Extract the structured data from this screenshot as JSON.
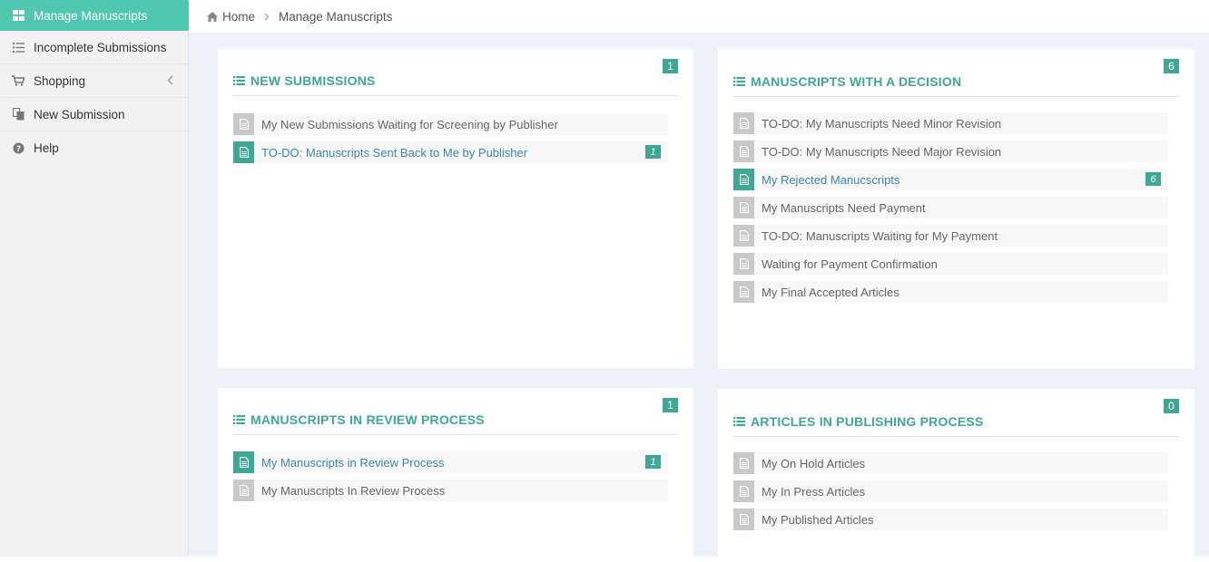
{
  "sidebar": {
    "items": [
      {
        "label": "Manage Manuscripts",
        "icon": "grid-icon",
        "active": true
      },
      {
        "label": "Incomplete Submissions",
        "icon": "list-icon"
      },
      {
        "label": "Shopping",
        "icon": "cart-icon",
        "has_submenu": true
      },
      {
        "label": "New Submission",
        "icon": "copy-icon"
      },
      {
        "label": "Help",
        "icon": "question-circle-icon"
      }
    ]
  },
  "breadcrumb": {
    "home": "Home",
    "current": "Manage Manuscripts"
  },
  "colors": {
    "accent": "#50c8b0",
    "title": "#3ea895",
    "link": "#3a86b0",
    "muted_icon": "#c9c9c9",
    "background": "#eef1f6"
  },
  "panels": {
    "new_submissions": {
      "title": "NEW SUBMISSIONS",
      "count": "1",
      "rows": [
        {
          "label": "My New Submissions Waiting for Screening by Publisher",
          "count": "",
          "highlight": false
        },
        {
          "label": "TO-DO: Manuscripts Sent Back to Me by Publisher",
          "count": "1",
          "highlight": true
        }
      ]
    },
    "decision": {
      "title": "MANUSCRIPTS WITH A DECISION",
      "count": "6",
      "rows": [
        {
          "label": "TO-DO: My Manuscripts Need Minor Revision",
          "count": "",
          "highlight": false
        },
        {
          "label": "TO-DO: My Manuscripts Need Major Revision",
          "count": "",
          "highlight": false
        },
        {
          "label": "My Rejected Manucscripts",
          "count": "6",
          "highlight": true
        },
        {
          "label": "My Manuscripts Need Payment",
          "count": "",
          "highlight": false
        },
        {
          "label": "TO-DO: Manuscripts Waiting for My Payment",
          "count": "",
          "highlight": false
        },
        {
          "label": "Waiting for Payment Confirmation",
          "count": "",
          "highlight": false
        },
        {
          "label": "My Final Accepted Articles",
          "count": "",
          "highlight": false
        }
      ]
    },
    "review": {
      "title": "MANUSCRIPTS IN REVIEW PROCESS",
      "count": "1",
      "rows": [
        {
          "label": "My Manuscripts in Review Process",
          "count": "1",
          "highlight": true
        },
        {
          "label": "My Manuscripts In Review Process",
          "count": "",
          "highlight": false
        }
      ]
    },
    "publishing": {
      "title": "ARTICLES IN PUBLISHING PROCESS",
      "count": "0",
      "rows": [
        {
          "label": "My On Hold Articles",
          "count": "",
          "highlight": false
        },
        {
          "label": "My In Press Articles",
          "count": "",
          "highlight": false
        },
        {
          "label": "My Published Articles",
          "count": "",
          "highlight": false
        }
      ]
    }
  }
}
